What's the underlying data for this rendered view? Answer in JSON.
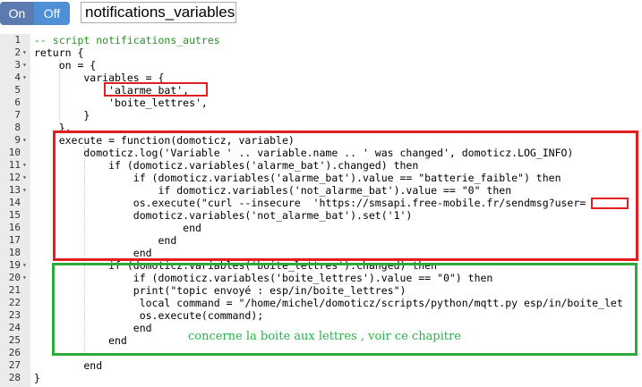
{
  "toolbar": {
    "on_label": "On",
    "off_label": "Off",
    "script_name": "notifications_variables"
  },
  "editor": {
    "lines": [
      {
        "num": "1",
        "fold": "",
        "text": "-- script notifications_autres"
      },
      {
        "num": "2",
        "fold": "▾",
        "text": "return {"
      },
      {
        "num": "3",
        "fold": "▾",
        "text": "    on = {"
      },
      {
        "num": "4",
        "fold": "▾",
        "text": "        variables = {"
      },
      {
        "num": "5",
        "fold": "",
        "text": "            'alarme_bat',"
      },
      {
        "num": "6",
        "fold": "",
        "text": "            'boite_lettres',"
      },
      {
        "num": "7",
        "fold": "",
        "text": "        }"
      },
      {
        "num": "8",
        "fold": "",
        "text": "    },"
      },
      {
        "num": "9",
        "fold": "▾",
        "text": "    execute = function(domoticz, variable)"
      },
      {
        "num": "10",
        "fold": "",
        "text": "        domoticz.log('Variable ' .. variable.name .. ' was changed', domoticz.LOG_INFO)"
      },
      {
        "num": "11",
        "fold": "▾",
        "text": "            if (domoticz.variables('alarme_bat').changed) then"
      },
      {
        "num": "12",
        "fold": "▾",
        "text": "                if (domoticz.variables('alarme_bat').value == \"batterie_faible\") then"
      },
      {
        "num": "13",
        "fold": "▾",
        "text": "                    if domoticz.variables('not_alarme_bat').value == \"0\" then"
      },
      {
        "num": "14",
        "fold": "",
        "text": "                os.execute(\"curl --insecure  'https://smsapi.free-mobile.fr/sendmsg?user="
      },
      {
        "num": "15",
        "fold": "",
        "text": "                domoticz.variables('not_alarme_bat').set('1')"
      },
      {
        "num": "16",
        "fold": "",
        "text": "                        end"
      },
      {
        "num": "17",
        "fold": "",
        "text": "                    end"
      },
      {
        "num": "18",
        "fold": "",
        "text": "                end"
      },
      {
        "num": "19",
        "fold": "▾",
        "text": "            if (domoticz.variables('boite_lettres').changed) then"
      },
      {
        "num": "20",
        "fold": "▾",
        "text": "                if (domoticz.variables('boite_lettres').value == \"0\") then"
      },
      {
        "num": "21",
        "fold": "",
        "text": "                print(\"topic envoyé : esp/in/boite_lettres\")"
      },
      {
        "num": "22",
        "fold": "",
        "text": "                 local command = \"/home/michel/domoticz/scripts/python/mqtt.py esp/in/boite_let"
      },
      {
        "num": "23",
        "fold": "",
        "text": "                 os.execute(command);"
      },
      {
        "num": "24",
        "fold": "",
        "text": "                end"
      },
      {
        "num": "25",
        "fold": "",
        "text": "            end"
      },
      {
        "num": "26",
        "fold": "",
        "text": ""
      },
      {
        "num": "27",
        "fold": "",
        "text": "        end"
      },
      {
        "num": "28",
        "fold": "",
        "text": "}"
      }
    ]
  },
  "annotation_text": "concerne la boite aux lettres , voir ce chapitre",
  "colors": {
    "red_box": "#e02020",
    "green_box": "#2eaa3a",
    "annotation": "#26b34a",
    "on_button": "#5b7ab0",
    "off_button": "#4f8fd6"
  }
}
